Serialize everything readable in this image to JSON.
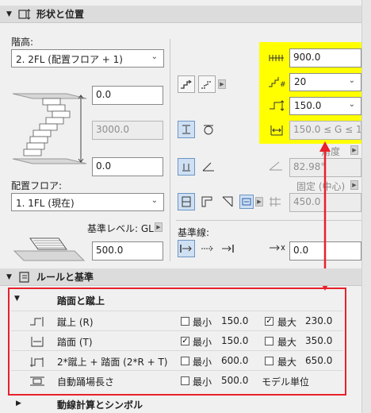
{
  "sections": {
    "shape": {
      "title": "形状と位置"
    },
    "rules": {
      "title": "ルールと基準"
    }
  },
  "story": {
    "label": "階高:",
    "select": "2. 2FL (配置フロア + 1)"
  },
  "heights": {
    "top_offset": "0.0",
    "total_height": "3000.0",
    "bottom_offset": "0.0"
  },
  "home_floor": {
    "label": "配置フロア:",
    "select": "1. 1FL (現在)"
  },
  "base_level": {
    "label": "基準レベル: GL",
    "value": "500.0"
  },
  "baseline": {
    "label": "基準線:",
    "value": "0.0"
  },
  "yellow_panel": {
    "width": "900.0",
    "riser_count": "20",
    "riser_height": "150.0",
    "going_range": "150.0 ≤ G ≤ 1"
  },
  "angle": {
    "label": "角度",
    "value": "82.98°"
  },
  "fixed": {
    "label": "固定 (中心)",
    "value": "450.0"
  },
  "rules": {
    "subsection": "踏面と蹴上",
    "rows": [
      {
        "name": "蹴上 (R)",
        "min_checked": false,
        "min_label": "最小",
        "min": "150.0",
        "max_checked": true,
        "max_label": "最大",
        "max": "230.0"
      },
      {
        "name": "踏面 (T)",
        "min_checked": true,
        "min_label": "最小",
        "min": "150.0",
        "max_checked": false,
        "max_label": "最大",
        "max": "350.0"
      },
      {
        "name": "2*蹴上 + 踏面 (2*R + T)",
        "min_checked": false,
        "min_label": "最小",
        "min": "600.0",
        "max_checked": false,
        "max_label": "最大",
        "max": "650.0"
      },
      {
        "name": "自動踊場長さ",
        "min_checked": false,
        "min_label": "最小",
        "min": "500.0",
        "extra": "モデル単位"
      }
    ],
    "next_subsection": "動線計算とシンボル"
  },
  "colors": {
    "highlight": "#ffff00",
    "annotation": "#e8212a"
  }
}
